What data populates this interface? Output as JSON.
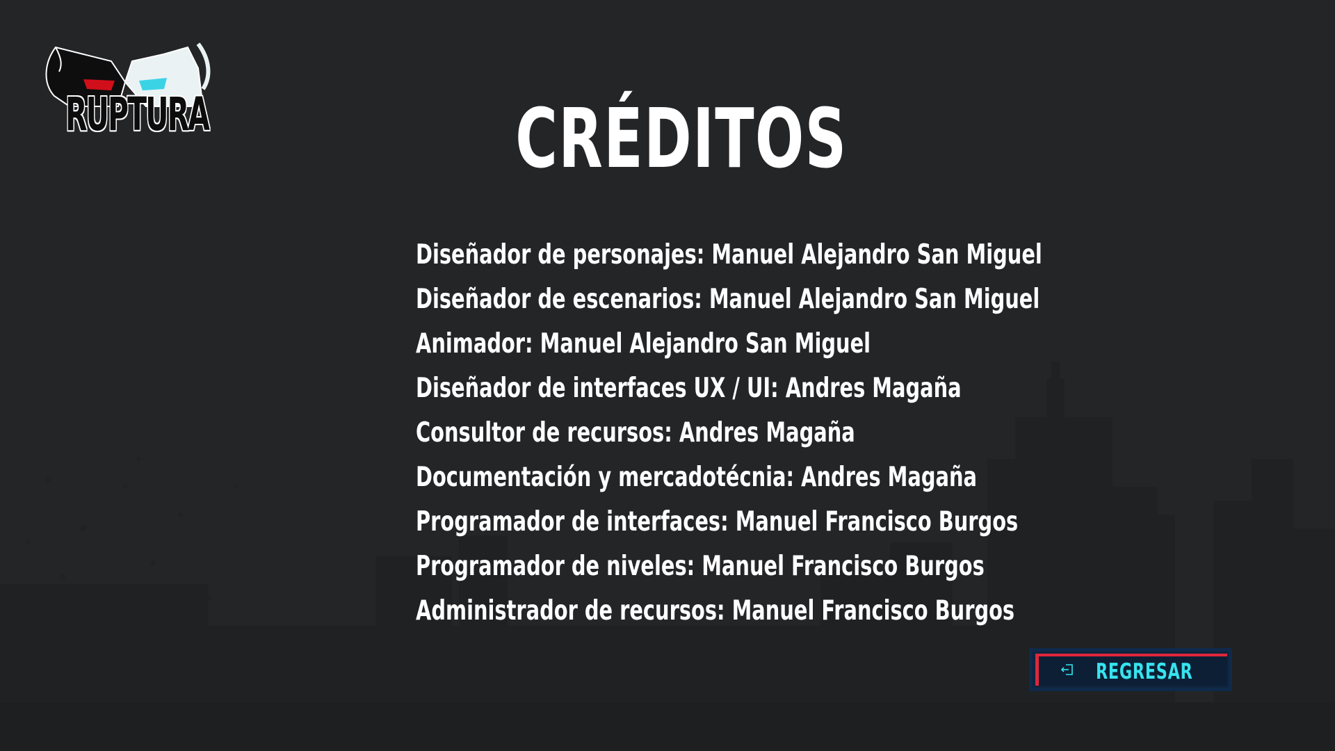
{
  "logo": {
    "text": "RUPTURA",
    "colors": {
      "eye_left": "#d10f1a",
      "eye_right": "#3ad3e6"
    }
  },
  "title": "CRÉDITOS",
  "credits": [
    "Diseñador de personajes: Manuel Alejandro San Miguel",
    "Diseñador de escenarios: Manuel Alejandro San Miguel",
    "Animador: Manuel Alejandro San Miguel",
    "Diseñador de interfaces UX / UI: Andres Magaña",
    "Consultor de recursos: Andres Magaña",
    "Documentación y mercadotécnia: Andres Magaña",
    "Programador de interfaces: Manuel Francisco Burgos",
    "Programador de niveles: Manuel Francisco Burgos",
    "Administrador de recursos: Manuel Francisco Burgos"
  ],
  "back_button": {
    "label": "REGRESAR",
    "icon": "exit-door-icon"
  },
  "colors": {
    "background": "#222426",
    "text": "#ffffff",
    "button_label": "#37e3ee",
    "button_accent": "#e0273a",
    "button_fill": "#0c1f35"
  }
}
